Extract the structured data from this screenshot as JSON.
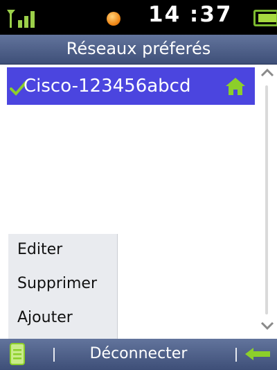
{
  "status_bar": {
    "time": "14 :37"
  },
  "header": {
    "title": "Réseaux préferés"
  },
  "networks": [
    {
      "name": "Cisco-123456abcd",
      "connected": true,
      "home": true
    }
  ],
  "context_menu": {
    "items": [
      "Editer",
      "Supprimer",
      "Ajouter"
    ]
  },
  "softkeys": {
    "center_label": "Déconnecter"
  },
  "colors": {
    "selection": "#4b45df",
    "bar": "#50628a",
    "accent_green": "#8ccf2a",
    "status_orange": "#f08a1a"
  }
}
